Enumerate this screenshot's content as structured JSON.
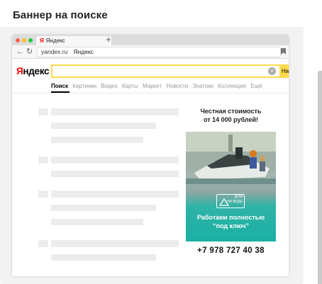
{
  "page": {
    "title": "Баннер на поиске"
  },
  "browser": {
    "tab_logo": "Я",
    "tab_label": "Яндекс",
    "new_tab": "+",
    "url_host": "yandex.ru",
    "url_title": "Яндекс",
    "window_dots": [
      "#ff5f57",
      "#febc2e",
      "#28c840"
    ]
  },
  "yandex": {
    "logo_first": "Я",
    "logo_rest": "ндекс",
    "search_button": "На",
    "clear_symbol": "×",
    "tabs": [
      "Поиск",
      "Картинки",
      "Видео",
      "Карты",
      "Маркет",
      "Новости",
      "Знатоки",
      "Коллекции",
      "Ещё"
    ],
    "active_tab": "Поиск"
  },
  "ad": {
    "headline_line1": "Честная стоимость",
    "headline_line2": "от 14 000 рублей!",
    "logo_text_line1": "ДОМ",
    "logo_text_line2": "НА ВОДЕ",
    "bottom_line1": "Работаем полностью",
    "bottom_line2": "“под ключ”",
    "phone": "+7 978 727 40 38",
    "accent_color": "#1ab0a3"
  }
}
